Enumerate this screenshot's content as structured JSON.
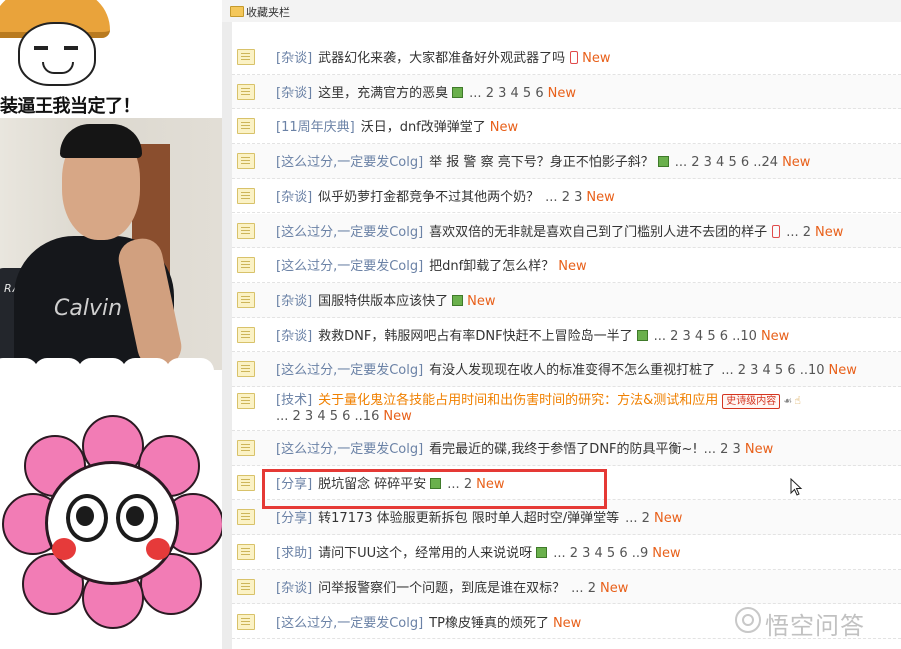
{
  "meme": {
    "caption": "装逼王我当定了！"
  },
  "camera": {
    "chair_brand": "RACER",
    "shirt_logo": "Calvin"
  },
  "bookmarks": {
    "folder_label": "收藏夹栏",
    "hint": ""
  },
  "threads": [
    {
      "category": "[杂谈]",
      "title": "武器幻化来袭，大家都准备好外观武器了吗",
      "pages": "",
      "new": "New",
      "icon": "phone"
    },
    {
      "category": "[杂谈]",
      "title": "这里，充满官方的恶臭",
      "pages": "... 2 3 4 5 6",
      "new": "New",
      "icon": "image"
    },
    {
      "category": "[11周年庆典]",
      "title": "沃日，dnf改弹弹堂了",
      "pages": "",
      "new": "New",
      "icon": ""
    },
    {
      "category": "[这么过分,一定要发Colg]",
      "title": "举 报 警 察 亮下号？身正不怕影子斜？",
      "pages": "... 2 3 4 5 6 ..24",
      "new": "New",
      "icon": "image"
    },
    {
      "category": "[杂谈]",
      "title": "似乎奶萝打金都竞争不过其他两个奶？",
      "pages": "... 2 3",
      "new": "New",
      "icon": ""
    },
    {
      "category": "[这么过分,一定要发Colg]",
      "title": "喜欢双倍的无非就是喜欢自己到了门槛别人进不去团的样子",
      "pages": "... 2",
      "new": "New",
      "icon": "phone"
    },
    {
      "category": "[这么过分,一定要发Colg]",
      "title": "把dnf卸载了怎么样？",
      "pages": "",
      "new": "New",
      "icon": ""
    },
    {
      "category": "[杂谈]",
      "title": "国服特供版本应该快了",
      "pages": "",
      "new": "New",
      "icon": "image"
    },
    {
      "category": "[杂谈]",
      "title": "救救DNF，韩服网吧占有率DNF快赶不上冒险岛一半了",
      "pages": "... 2 3 4 5 6 ..10",
      "new": "New",
      "icon": "image"
    },
    {
      "category": "[这么过分,一定要发Colg]",
      "title": "有没人发现现在收人的标准变得不怎么重视打桩了",
      "pages": "... 2 3 4 5 6 ..10",
      "new": "New",
      "icon": ""
    },
    {
      "category": "[技术]",
      "title": "关于量化鬼泣各技能占用时间和出伤害时间的研究：方法&测试和应用",
      "badge": "史诗级内容",
      "pages": "... 2 3 4 5 6 ..16",
      "new": "New",
      "icon": ""
    },
    {
      "category": "[这么过分,一定要发Colg]",
      "title": "看完最近的碟,我终于参悟了DNF的防具平衡~!",
      "pages": "... 2 3",
      "new": "New",
      "icon": ""
    },
    {
      "category": "[分享]",
      "title": "脱坑留念 碎碎平安",
      "pages": "... 2",
      "new": "New",
      "icon": "image"
    },
    {
      "category": "[分享]",
      "title": "转17173 体验服更新拆包 限时单人超时空/弹弹堂等",
      "pages": "... 2",
      "new": "New",
      "icon": ""
    },
    {
      "category": "[求助]",
      "title": "请问下UU这个，经常用的人来说说呀",
      "pages": "... 2 3 4 5 6 ..9",
      "new": "New",
      "icon": "image"
    },
    {
      "category": "[杂谈]",
      "title": "问举报警察们一个问题，到底是谁在双标？",
      "pages": "... 2",
      "new": "New",
      "icon": ""
    },
    {
      "category": "[这么过分,一定要发Colg]",
      "title": "TP橡皮锤真的烦死了",
      "pages": "",
      "new": "New",
      "icon": ""
    }
  ],
  "watermark": {
    "text": "悟空问答"
  },
  "colors": {
    "category": "#6b82a6",
    "new": "#e8601a",
    "highlight_title": "#f08000",
    "box": "#e53935"
  }
}
